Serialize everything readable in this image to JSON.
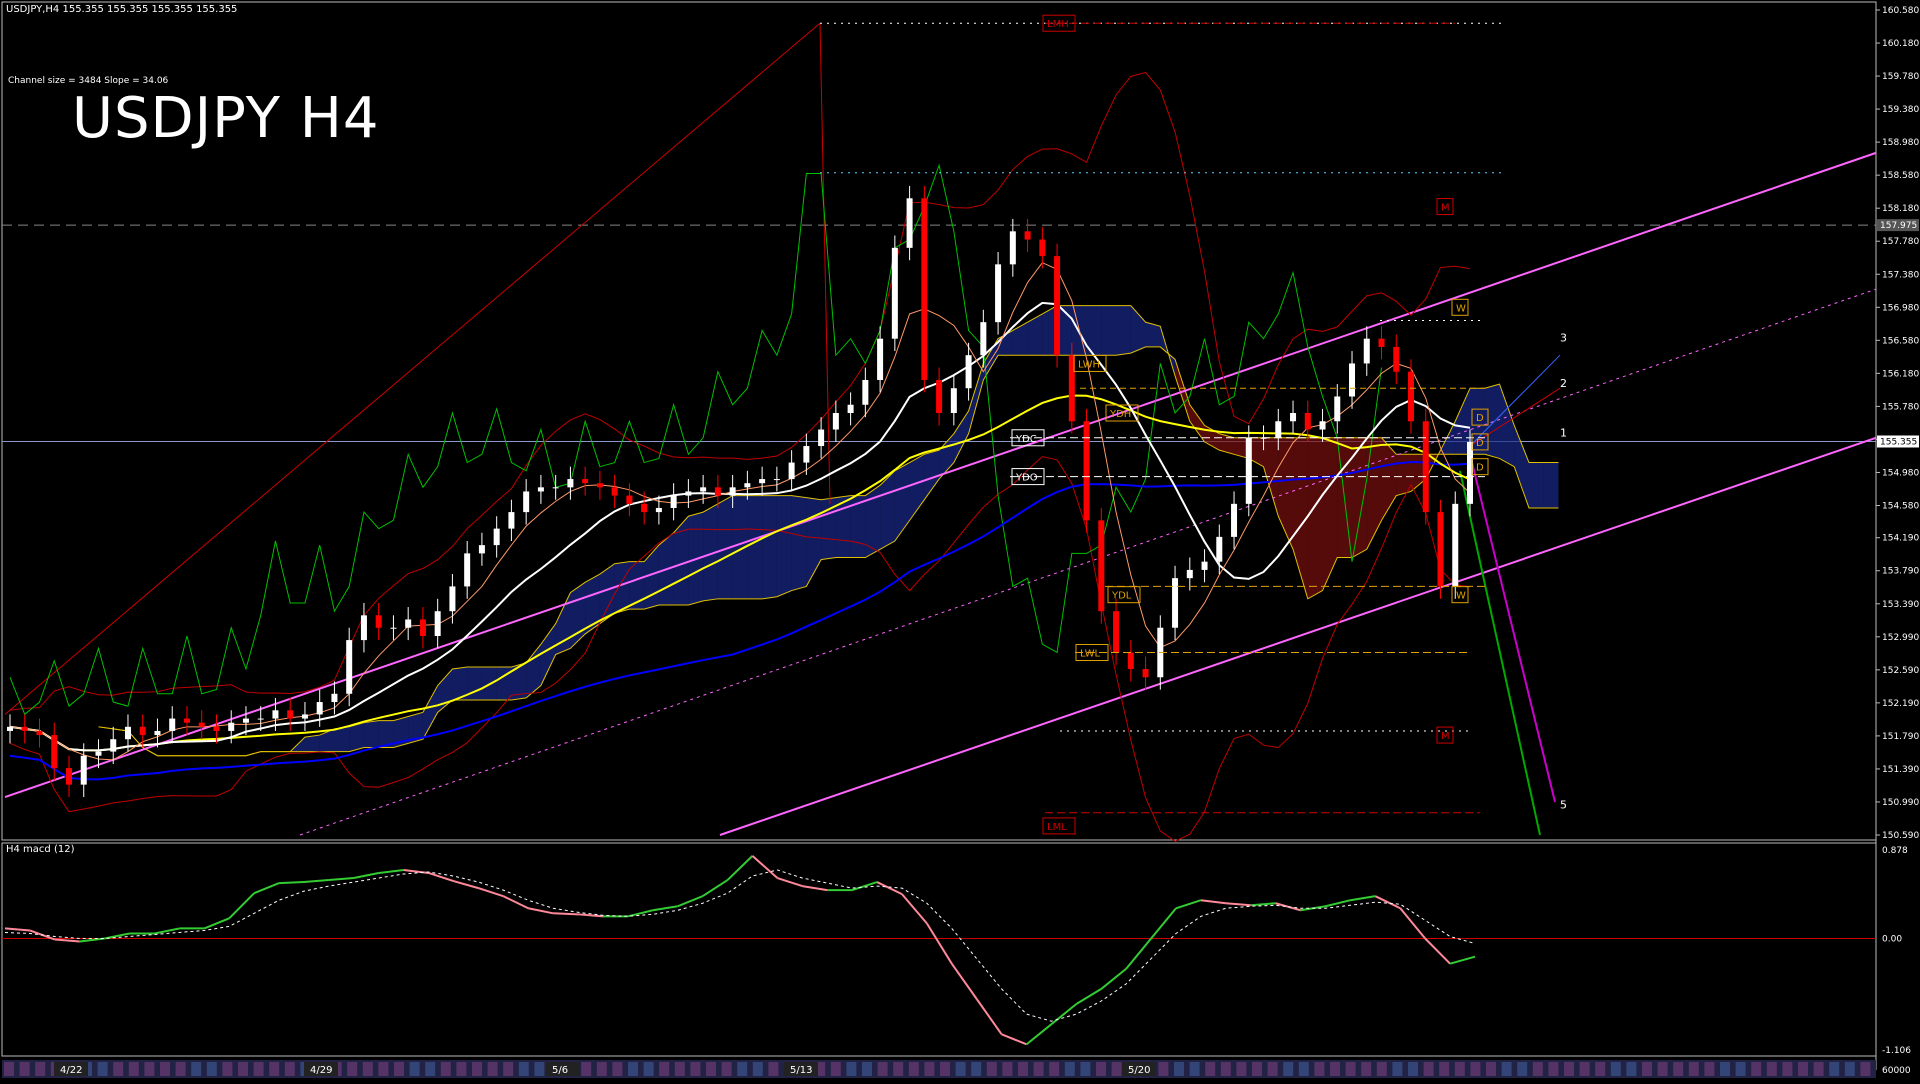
{
  "header": {
    "text": "USDJPY,H4  155.355 155.355 155.355 155.355"
  },
  "channel_info": "Channel size = 3484 Slope = 34.06",
  "big_title": "USDJPY H4",
  "subwindow": {
    "label": "H4  macd (12)"
  },
  "levels": {
    "LMH": "LMH",
    "LML": "LML",
    "M_top": "M",
    "M_bottom": "M",
    "LWH": "LWH",
    "LWL": "LWL",
    "YDH": "YDH",
    "YDL": "YDL",
    "YDC": "YDC",
    "YDO": "YDO",
    "W_top": "W",
    "W_bottom": "W",
    "D1": "D",
    "D2": "D",
    "D3": "D"
  },
  "channel_marks": [
    "3",
    "2",
    "1",
    "5"
  ],
  "current_price": "155.355",
  "price_tag_2": "157.975",
  "colors": {
    "candle_up": "#ffffff",
    "candle_down": "#ff0000",
    "channel": "#ff66ff",
    "ma_yellow": "#ffff00",
    "ma_blue": "#0000ff",
    "ma_white": "#ffffff",
    "chikou": "#00c000",
    "bollinger": "#c00000",
    "macd_pos": "#33cc33",
    "macd_neg": "#ff8899"
  },
  "chart_data": {
    "type": "line",
    "title": "USDJPY H4",
    "xlabel": "",
    "ylabel": "",
    "ylim": [
      150.59,
      160.58
    ],
    "y_ticks": [
      "160.580",
      "160.180",
      "159.780",
      "159.380",
      "158.980",
      "158.580",
      "158.180",
      "157.780",
      "157.380",
      "156.980",
      "156.580",
      "156.180",
      "155.780",
      "155.380",
      "154.980",
      "154.580",
      "154.190",
      "153.790",
      "153.390",
      "152.990",
      "152.590",
      "152.190",
      "151.790",
      "151.390",
      "150.990",
      "150.590"
    ],
    "x_ticks": [
      "4/22",
      "4/29",
      "5/6",
      "5/13",
      "5/20"
    ],
    "macd_ticks": [
      "0.878",
      "0.00",
      "-1.106"
    ],
    "macd_bottom_label": "60000",
    "macd_ylim": [
      -1.106,
      0.878
    ],
    "closes": [
      151.9,
      151.85,
      151.8,
      151.4,
      151.2,
      151.55,
      151.6,
      151.75,
      151.9,
      151.8,
      151.85,
      152.0,
      151.95,
      151.9,
      151.85,
      151.95,
      152.0,
      152.0,
      152.1,
      152.0,
      152.05,
      152.2,
      152.3,
      152.95,
      153.25,
      153.1,
      153.1,
      153.2,
      153.0,
      153.3,
      153.6,
      154.0,
      154.1,
      154.3,
      154.5,
      154.75,
      154.8,
      154.8,
      154.9,
      154.85,
      154.8,
      154.7,
      154.6,
      154.5,
      154.55,
      154.7,
      154.75,
      154.8,
      154.7,
      154.8,
      154.85,
      154.9,
      154.9,
      155.1,
      155.3,
      155.5,
      155.7,
      155.8,
      156.1,
      156.6,
      157.7,
      158.3,
      156.1,
      155.7,
      156.0,
      156.4,
      156.8,
      157.5,
      157.9,
      157.8,
      157.6,
      156.4,
      155.6,
      154.4,
      153.3,
      152.8,
      152.6,
      152.5,
      153.1,
      153.7,
      153.8,
      153.9,
      154.2,
      154.6,
      155.4,
      155.4,
      155.6,
      155.7,
      155.5,
      155.6,
      155.9,
      156.3,
      156.6,
      156.5,
      156.2,
      155.6,
      154.5,
      153.6,
      154.6,
      155.35
    ],
    "macd": [
      0.1,
      0.08,
      -0.01,
      -0.03,
      0.0,
      0.05,
      0.05,
      0.1,
      0.1,
      0.2,
      0.45,
      0.55,
      0.56,
      0.58,
      0.6,
      0.65,
      0.68,
      0.65,
      0.57,
      0.5,
      0.42,
      0.3,
      0.25,
      0.24,
      0.22,
      0.22,
      0.28,
      0.32,
      0.42,
      0.58,
      0.82,
      0.6,
      0.52,
      0.48,
      0.48,
      0.56,
      0.44,
      0.15,
      -0.25,
      -0.6,
      -0.95,
      -1.05,
      -0.85,
      -0.65,
      -0.5,
      -0.3,
      0.0,
      0.3,
      0.38,
      0.35,
      0.33,
      0.35,
      0.28,
      0.32,
      0.38,
      0.42,
      0.3,
      0.0,
      -0.25,
      -0.18
    ],
    "macd_signal": [
      0.06,
      0.05,
      0.02,
      0.0,
      0.0,
      0.02,
      0.04,
      0.06,
      0.08,
      0.12,
      0.25,
      0.38,
      0.47,
      0.52,
      0.56,
      0.6,
      0.64,
      0.66,
      0.62,
      0.56,
      0.48,
      0.38,
      0.3,
      0.26,
      0.23,
      0.22,
      0.24,
      0.28,
      0.35,
      0.45,
      0.62,
      0.68,
      0.6,
      0.55,
      0.5,
      0.52,
      0.5,
      0.35,
      0.1,
      -0.2,
      -0.5,
      -0.75,
      -0.82,
      -0.75,
      -0.62,
      -0.45,
      -0.2,
      0.05,
      0.22,
      0.3,
      0.32,
      0.33,
      0.3,
      0.3,
      0.33,
      0.36,
      0.34,
      0.18,
      0.02,
      -0.05
    ]
  }
}
